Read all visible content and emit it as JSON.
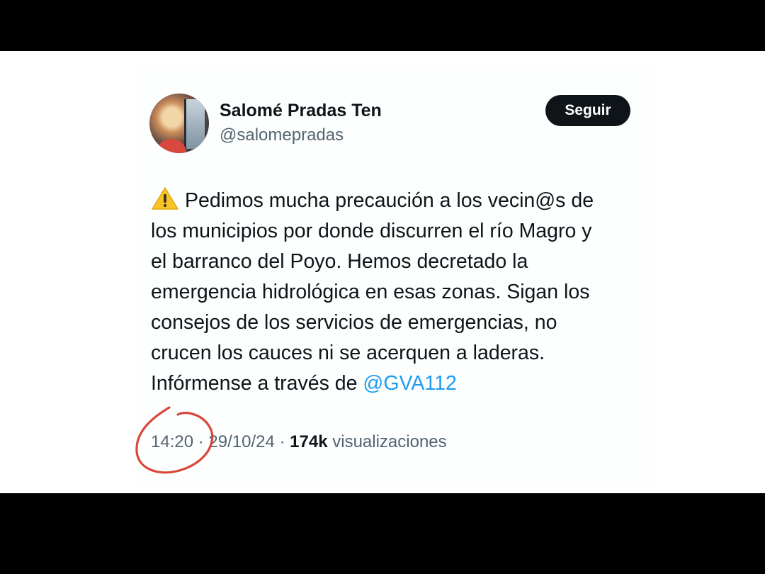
{
  "colors": {
    "background_bars": "#000000",
    "card": "#ffffff",
    "text_primary": "#0f1419",
    "text_secondary": "#536471",
    "link": "#1d9bf0",
    "button_bg": "#0f1419",
    "button_text": "#ffffff",
    "annotation_circle": "#d9473b"
  },
  "author": {
    "display_name": "Salomé Pradas Ten",
    "handle": "@salomepradas",
    "follow_label": "Seguir"
  },
  "tweet": {
    "icon": "warning-icon",
    "lines": [
      "Pedimos mucha precaución a los vecin@s de",
      "los municipios por donde discurren el río Magro y",
      "el barranco del Poyo. Hemos decretado la",
      "emergencia hidrológica en esas zonas. Sigan los",
      "consejos de los servicios de emergencias, no",
      "crucen los cauces ni se acerquen a laderas.",
      "Infórmense a través de"
    ],
    "mention": "@GVA112"
  },
  "meta": {
    "time": "14:20",
    "separator": "·",
    "date": "29/10/24",
    "views_count": "174k",
    "views_label": "visualizaciones"
  }
}
